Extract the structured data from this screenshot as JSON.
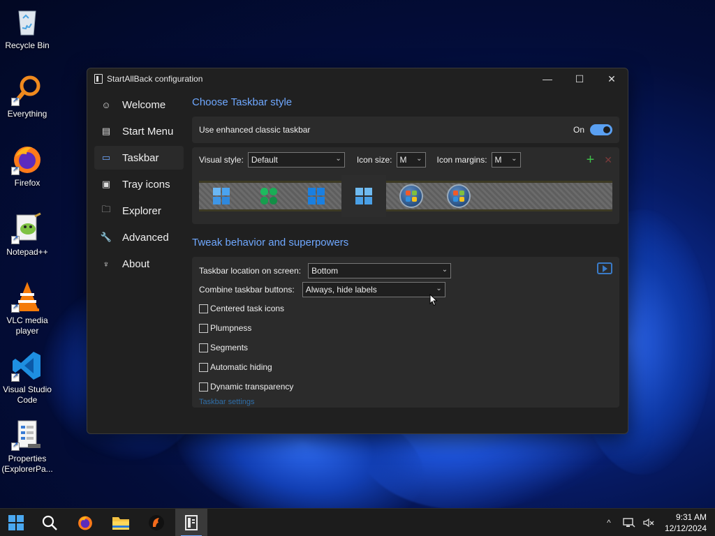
{
  "desktop": {
    "icons": [
      {
        "label_line1": "Recycle Bin",
        "label_line2": "",
        "icon": "recycle-bin-icon"
      },
      {
        "label_line1": "Everything",
        "label_line2": "",
        "icon": "everything-search-icon"
      },
      {
        "label_line1": "Firefox",
        "label_line2": "",
        "icon": "firefox-icon"
      },
      {
        "label_line1": "Notepad++",
        "label_line2": "",
        "icon": "notepad-plus-plus-icon"
      },
      {
        "label_line1": "VLC media",
        "label_line2": "player",
        "icon": "vlc-icon"
      },
      {
        "label_line1": "Visual Studio",
        "label_line2": "Code",
        "icon": "vscode-icon"
      },
      {
        "label_line1": "Properties",
        "label_line2": "(ExplorerPa...",
        "icon": "properties-icon"
      }
    ]
  },
  "window": {
    "title": "StartAllBack configuration",
    "controls": {
      "minimize": "—",
      "maximize": "☐",
      "close": "✕"
    }
  },
  "sidebar": {
    "items": [
      {
        "label": "Welcome",
        "icon": "smile-icon",
        "glyph": "☺"
      },
      {
        "label": "Start Menu",
        "icon": "start-menu-icon",
        "glyph": "▤"
      },
      {
        "label": "Taskbar",
        "icon": "taskbar-icon",
        "glyph": "▭"
      },
      {
        "label": "Tray icons",
        "icon": "tray-icons-icon",
        "glyph": "▣"
      },
      {
        "label": "Explorer",
        "icon": "folder-icon",
        "glyph": "🗀"
      },
      {
        "label": "Advanced",
        "icon": "wrench-icon",
        "glyph": "🔧"
      },
      {
        "label": "About",
        "icon": "about-icon",
        "glyph": "♆"
      }
    ],
    "active": "Taskbar"
  },
  "taskbar_style": {
    "section_title": "Choose Taskbar style",
    "enhanced_label": "Use enhanced classic taskbar",
    "enhanced_state": "On",
    "visual_style_label": "Visual style:",
    "visual_style_value": "Default",
    "icon_size_label": "Icon size:",
    "icon_size_value": "M",
    "icon_margins_label": "Icon margins:",
    "icon_margins_value": "M",
    "add_glyph": "+",
    "remove_glyph": "✕"
  },
  "tweaks": {
    "section_title": "Tweak behavior and superpowers",
    "location_label": "Taskbar location on screen:",
    "location_value": "Bottom",
    "combine_label": "Combine taskbar buttons:",
    "combine_value": "Always, hide labels",
    "checkboxes": [
      {
        "label": "Centered task icons",
        "checked": false
      },
      {
        "label": "Plumpness",
        "checked": false
      },
      {
        "label": "Segments",
        "checked": false
      },
      {
        "label": "Automatic hiding",
        "checked": false
      },
      {
        "label": "Dynamic transparency",
        "checked": false
      }
    ],
    "settings_link": "Taskbar settings"
  },
  "system_taskbar": {
    "apps": [
      "start-icon",
      "search-icon",
      "firefox-icon",
      "file-explorer-icon",
      "app-icon",
      "startallback-icon"
    ],
    "tray_chevron": "^",
    "clock_time": "9:31 AM",
    "clock_date": "12/12/2024"
  },
  "colors": {
    "accent": "#6fa8ff",
    "window_bg": "#202020",
    "card_bg": "#2b2b2b"
  }
}
